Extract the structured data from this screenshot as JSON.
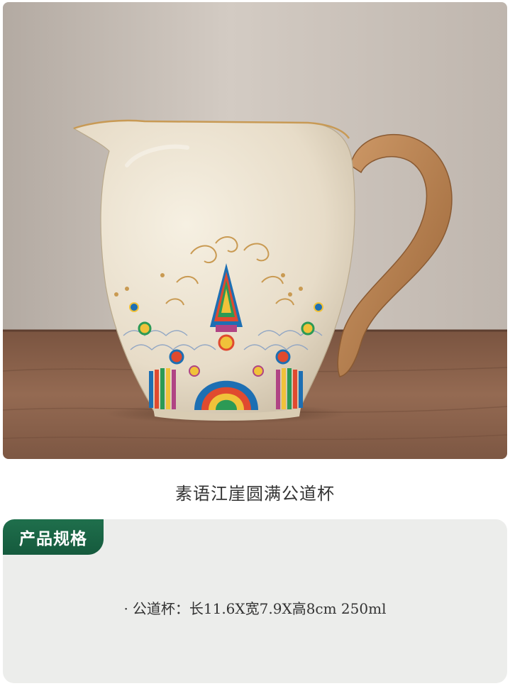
{
  "product": {
    "title": "素语江崖圆满公道杯"
  },
  "spec": {
    "tab_label": "产品规格",
    "bullet": "·",
    "line": "公道杯：长11.6X宽7.9X高8cm 250ml"
  },
  "photo": {
    "subject": "pitcher-icon",
    "colors": {
      "wall": "#c9bfb6",
      "table": "#8a6048",
      "body": "#ece4d3",
      "handle": "#b97e4c"
    }
  }
}
